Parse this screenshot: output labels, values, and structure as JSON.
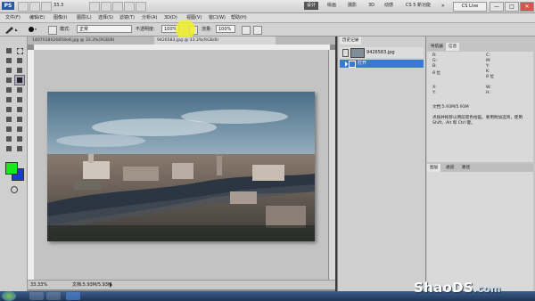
{
  "app": {
    "logo": "PS",
    "zoom": "33.3",
    "workspaces": [
      "设计",
      "绘画",
      "摄影",
      "3D",
      "动感",
      "CS 5 新功能"
    ],
    "active_workspace": "设计",
    "cslive": "CS Live",
    "window_buttons": [
      "—",
      "□",
      "✕"
    ]
  },
  "menubar": [
    "文件(F)",
    "编辑(E)",
    "图像(I)",
    "图层(L)",
    "选择(S)",
    "滤镜(T)",
    "分析(A)",
    "3D(D)",
    "视图(V)",
    "窗口(W)",
    "帮助(H)"
  ],
  "options": {
    "mode_label": "模式:",
    "mode_value": "正常",
    "opacity_label": "不透明度:",
    "opacity_value": "100%",
    "flow_label": "流量:",
    "flow_value": "100%"
  },
  "document": {
    "tabs": [
      "1407018026858e8.jpg @ 33.3%(RGB/8)",
      "9426583.jpg @ 33.3%(RGB/8)"
    ],
    "active_tab": 1,
    "status_zoom": "33.33%",
    "status_doc": "文档:5.93M/5.93M"
  },
  "history": {
    "tabs": [
      "历史记录"
    ],
    "snapshot_name": "9426583.jpg",
    "items": [
      "打开"
    ]
  },
  "info": {
    "tabs": [
      "导航器",
      "信息"
    ],
    "active_tab": "信息",
    "left_col": [
      "R:",
      "G:",
      "B:",
      "8 位"
    ],
    "right_col": [
      "C:",
      "M:",
      "Y:",
      "K:",
      "8 位"
    ],
    "xy": [
      "X:",
      "Y:"
    ],
    "wh": [
      "W:",
      "H:"
    ],
    "doc_size": "文档:5.93M/5.93M",
    "hint": "点按并拖移以用前景色绘画。要用附加选项，使用 Shift、Alt 和 Ctrl 键。"
  },
  "lower_panel": {
    "tabs": [
      "图层",
      "通道",
      "路径"
    ]
  },
  "colors": {
    "foreground": "#18e818",
    "background": "#1a3ad0",
    "workspace_active": "#555555",
    "history_selected": "#3a78d6"
  },
  "watermark": {
    "main": "ShaoDS",
    "suffix": ".com"
  }
}
